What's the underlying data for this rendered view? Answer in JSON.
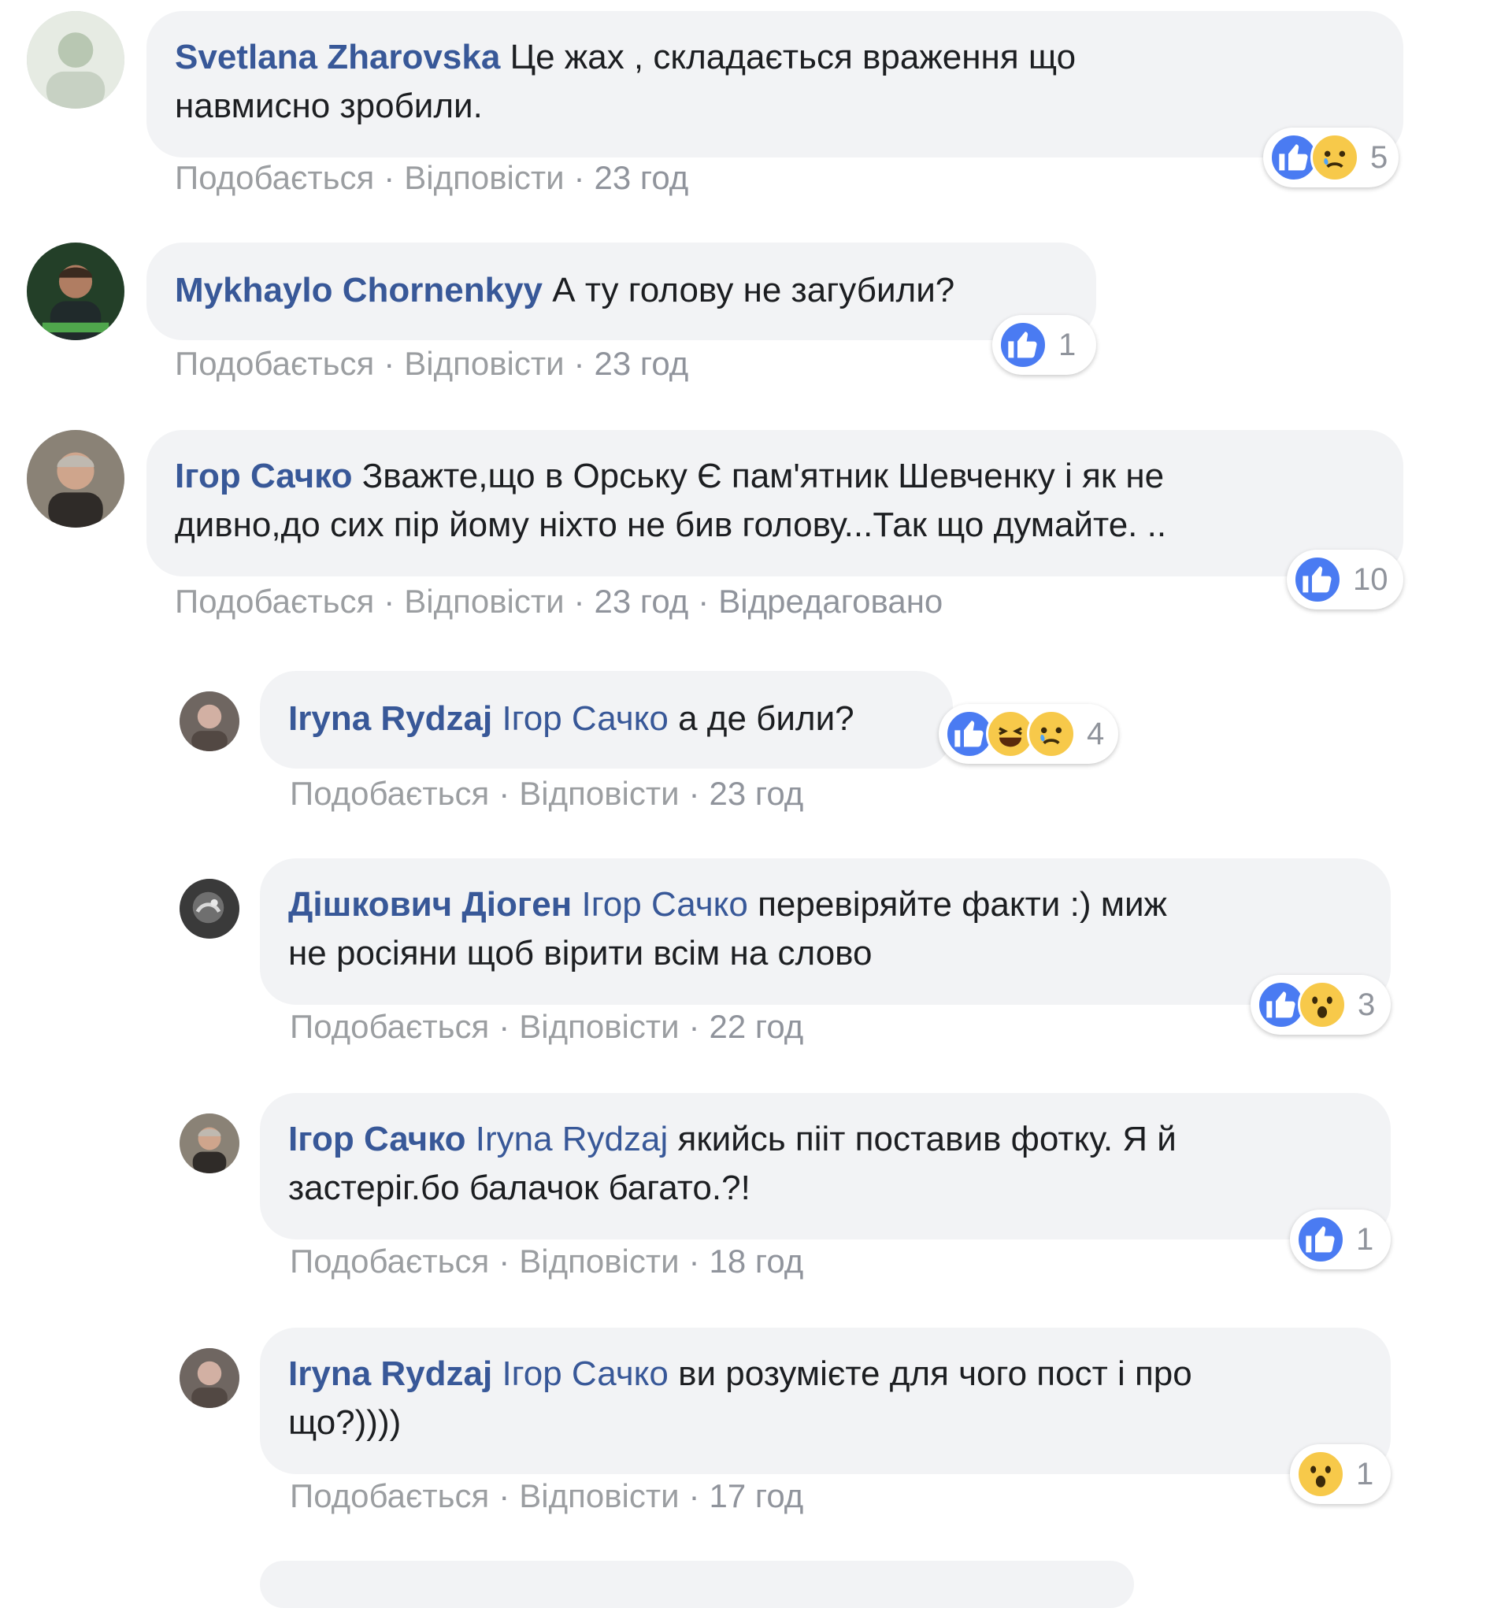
{
  "actions": {
    "like": "Подобається",
    "reply": "Відповісти",
    "edited": "Відредаговано"
  },
  "comments": [
    {
      "author": "Svetlana Zharovska",
      "text_line1": "Це жах , складається враження що",
      "text_line2": "навмисно зробили.",
      "time": "23 год",
      "reactions": [
        "like",
        "sad"
      ],
      "reaction_count": "5"
    },
    {
      "author": "Mykhaylo Chornenkyy",
      "text_line1": "А ту голову не загубили?",
      "time": "23 год",
      "reactions": [
        "like"
      ],
      "reaction_count": "1"
    },
    {
      "author": "Ігор Сачко",
      "text_line1": "Зважте,що в Орську Є пам'ятник Шевченку і як не",
      "text_line2": "дивно,до сих пір йому ніхто не бив голову...Так що думайте. ..",
      "time": "23 год",
      "edited": true,
      "reactions": [
        "like"
      ],
      "reaction_count": "10"
    }
  ],
  "replies": [
    {
      "author": "Iryna Rydzaj",
      "mention": "Ігор Сачко",
      "text_line1": "а де били?",
      "time": "23 год",
      "reactions": [
        "like",
        "haha",
        "sad"
      ],
      "reaction_count": "4"
    },
    {
      "author": "Дішкович Діоген",
      "mention": "Ігор Сачко",
      "text_line1": "перевіряйте факти :)  миж",
      "text_line2": "не росіяни щоб вірити всім на слово",
      "time": "22 год",
      "reactions": [
        "like",
        "wow"
      ],
      "reaction_count": "3"
    },
    {
      "author": "Ігор Сачко",
      "mention": "Iryna Rydzaj",
      "text_line1": "якийсь пііт поставив фотку. Я й",
      "text_line2": "застеріг.бо балачок багато.?!",
      "time": "18 год",
      "reactions": [
        "like"
      ],
      "reaction_count": "1"
    },
    {
      "author": "Iryna Rydzaj",
      "mention": "Ігор Сачко",
      "text_line1": "ви розумієте для чого пост і про",
      "text_line2": "що?))))",
      "time": "17 год",
      "reactions": [
        "wow"
      ],
      "reaction_count": "1"
    }
  ]
}
